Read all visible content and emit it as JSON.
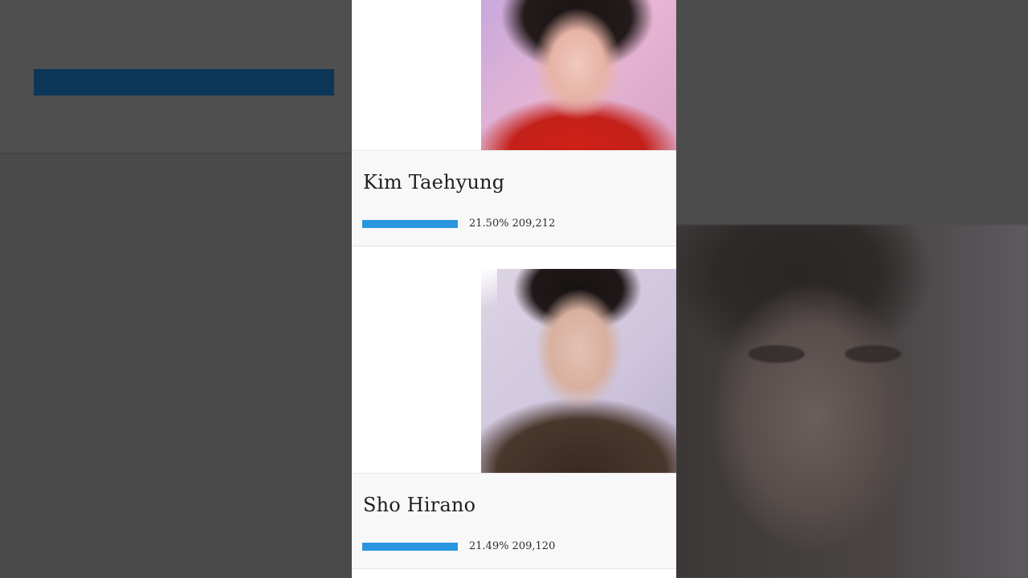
{
  "colors": {
    "bar": "#2a95df",
    "background_accent": "#0c3657",
    "card": "#f8f8f8"
  },
  "candidates": [
    {
      "name": "Kim Taehyung",
      "percent": "21.50%",
      "votes": "209,212",
      "share": 21.5
    },
    {
      "name": "Sho Hirano",
      "percent": "21.49%",
      "votes": "209,120",
      "share": 21.49
    }
  ]
}
